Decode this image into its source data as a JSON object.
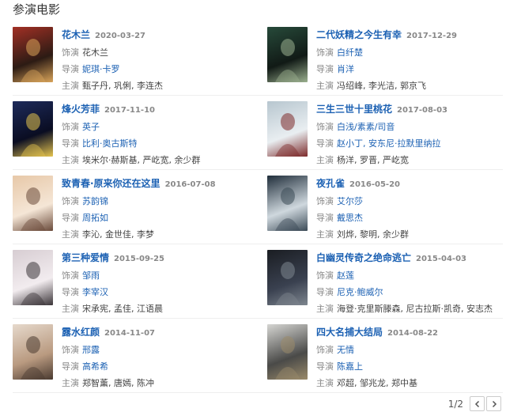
{
  "section_title": "参演电影",
  "labels": {
    "role": "饰演",
    "director": "导演",
    "cast": "主演"
  },
  "movies": [
    {
      "title": "花木兰",
      "date": "2020-03-27",
      "role": "花木兰",
      "director": "妮琪·卡罗",
      "cast": "甄子丹, 巩俐, 李连杰",
      "poster_colors": [
        "#a23025",
        "#2c1b14",
        "#d9a45a"
      ]
    },
    {
      "title": "二代妖精之今生有幸",
      "date": "2017-12-29",
      "role": "白纤楚",
      "director": "肖洋",
      "cast": "冯绍峰, 李光洁, 郭京飞",
      "poster_colors": [
        "#274a3a",
        "#111a16",
        "#9bb08f"
      ]
    },
    {
      "title": "烽火芳菲",
      "date": "2017-11-10",
      "role": "英子",
      "director": "比利·奥古斯特",
      "cast": "埃米尔·赫斯基, 严屹宽, 余少群",
      "poster_colors": [
        "#1d2a5a",
        "#0a0d22",
        "#e5c44e"
      ]
    },
    {
      "title": "三生三世十里桃花",
      "date": "2017-08-03",
      "role": "白浅/素素/司音",
      "director": "赵小丁, 安东尼·拉默里纳拉",
      "cast": "杨洋, 罗晋, 严屹宽",
      "poster_colors": [
        "#b7c6cf",
        "#e9eef1",
        "#7d2a2a"
      ]
    },
    {
      "title": "致青春·原来你还在这里",
      "date": "2016-07-08",
      "role": "苏韵锦",
      "director": "周拓如",
      "cast": "李沁, 金世佳, 李梦",
      "poster_colors": [
        "#e7c8a8",
        "#f5e6d6",
        "#6a4a3a"
      ]
    },
    {
      "title": "夜孔雀",
      "date": "2016-05-20",
      "role": "艾尔莎",
      "director": "戴思杰",
      "cast": "刘烨, 黎明, 余少群",
      "poster_colors": [
        "#1f2d3a",
        "#cfd8de",
        "#3b4a56"
      ]
    },
    {
      "title": "第三种爱情",
      "date": "2015-09-25",
      "role": "邹雨",
      "director": "李宰汉",
      "cast": "宋承宪, 孟佳, 江语晨",
      "poster_colors": [
        "#d7cdd2",
        "#f2ecef",
        "#3a3438"
      ]
    },
    {
      "title": "白幽灵传奇之绝命逃亡",
      "date": "2015-04-03",
      "role": "赵莲",
      "director": "尼克·鲍威尔",
      "cast": "海登·克里斯滕森, 尼古拉斯·凯奇, 安志杰",
      "poster_colors": [
        "#1a1d22",
        "#3a4150",
        "#7e868f"
      ]
    },
    {
      "title": "露水红颜",
      "date": "2014-11-07",
      "role": "邢露",
      "director": "高希希",
      "cast": "郑智薰, 唐嫣, 陈冲",
      "poster_colors": [
        "#e6d9cc",
        "#b99a80",
        "#4a3a30"
      ]
    },
    {
      "title": "四大名捕大结局",
      "date": "2014-08-22",
      "role": "无情",
      "director": "陈嘉上",
      "cast": "邓超, 邹兆龙, 郑中基",
      "poster_colors": [
        "#d6d6d3",
        "#4a4a48",
        "#9a8a6a"
      ]
    }
  ],
  "pager": {
    "page_text": "1/2"
  }
}
